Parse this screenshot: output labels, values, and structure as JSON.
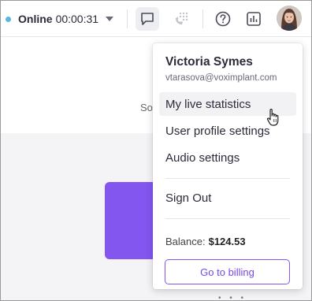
{
  "header": {
    "status_label": "Online",
    "status_timer": "00:00:31",
    "status_color": "#58b7e0"
  },
  "background": {
    "sort_label": "Sort by"
  },
  "user_menu": {
    "name": "Victoria Symes",
    "email": "vtarasova@voximplant.com",
    "items": [
      {
        "label": "My live statistics"
      },
      {
        "label": "User profile settings"
      },
      {
        "label": "Audio settings"
      }
    ],
    "sign_out_label": "Sign Out",
    "balance_label": "Balance:",
    "balance_value": "$124.53",
    "billing_button_label": "Go to billing",
    "accent_color": "#7448e8"
  }
}
